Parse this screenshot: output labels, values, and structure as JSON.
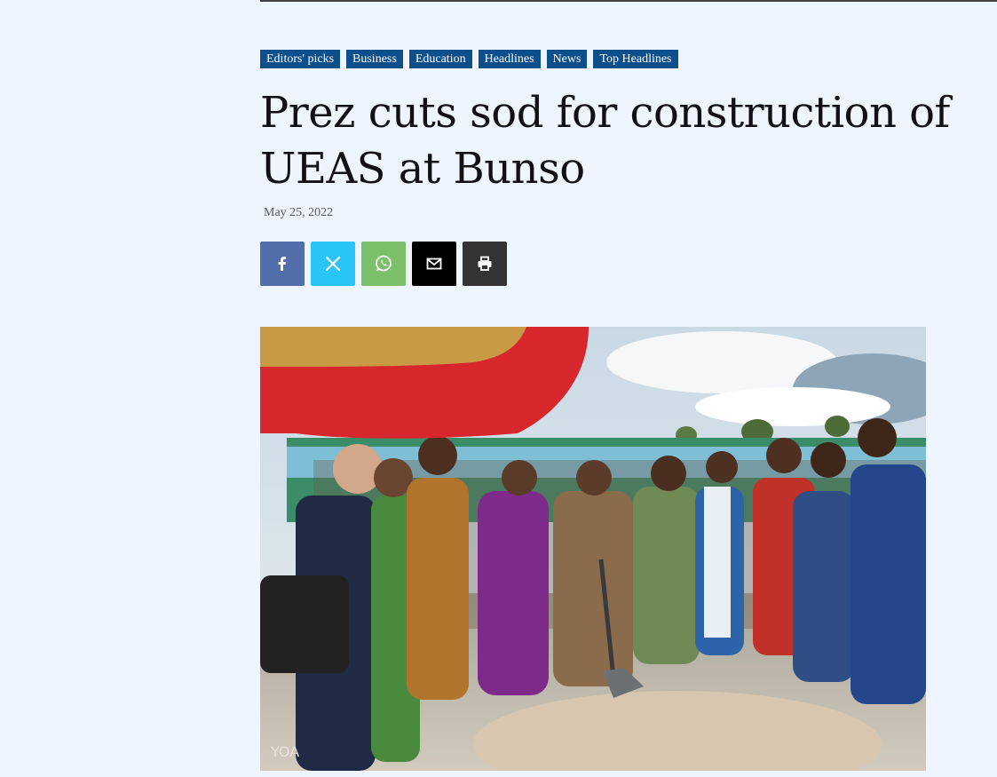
{
  "article": {
    "categories": [
      "Editors' picks",
      "Business",
      "Education",
      "Headlines",
      "News",
      "Top Headlines"
    ],
    "title": "Prez cuts sod for construction of UEAS at Bunso",
    "date": "May 25, 2022",
    "photo_watermark": "YOA"
  },
  "share": [
    {
      "name": "facebook",
      "icon": "facebook-icon",
      "color": "#516eab"
    },
    {
      "name": "twitter",
      "icon": "x-icon",
      "color": "#29c5f6"
    },
    {
      "name": "whatsapp",
      "icon": "whatsapp-icon",
      "color": "#7bbf6a"
    },
    {
      "name": "email",
      "icon": "envelope-icon",
      "color": "#000000"
    },
    {
      "name": "print",
      "icon": "printer-icon",
      "color": "#333333"
    }
  ],
  "colors": {
    "page_background": "#eef5ff",
    "category_tag": "#0c4f8a"
  }
}
